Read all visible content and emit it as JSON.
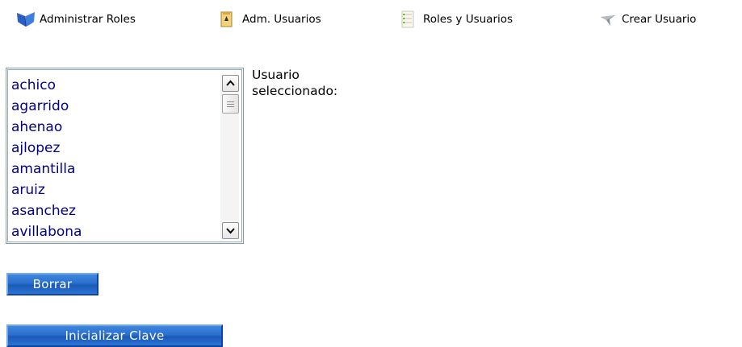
{
  "toolbar": {
    "items": [
      {
        "label": "Administrar Roles",
        "icon": "roles-icon"
      },
      {
        "label": "Adm. Usuarios",
        "icon": "user-admin-icon"
      },
      {
        "label": "Roles y Usuarios",
        "icon": "list-icon"
      },
      {
        "label": "Crear Usuario",
        "icon": "create-user-icon"
      }
    ]
  },
  "users": {
    "items": [
      "achico",
      "agarrido",
      "ahenao",
      "ajlopez",
      "amantilla",
      "aruiz",
      "asanchez",
      "avillabona"
    ]
  },
  "selected_user": {
    "label_line1": "Usuario",
    "label_line2": "seleccionado:"
  },
  "actions": {
    "delete_label": "Borrar",
    "reset_password_label": "Inicializar Clave"
  },
  "colors": {
    "button_blue": "#2a6fcf",
    "list_text": "#00008b",
    "list_border": "#7f9db9"
  }
}
